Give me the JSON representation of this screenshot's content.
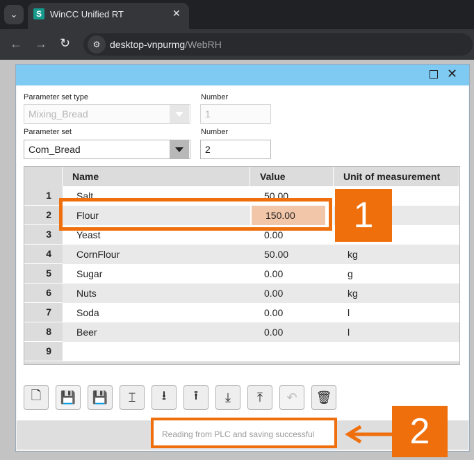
{
  "browser": {
    "tab_title": "WinCC Unified RT",
    "tab_favicon": "S",
    "url_host": "desktop-vnpurmg",
    "url_path": "/WebRH"
  },
  "form": {
    "param_type_label": "Parameter set type",
    "param_type_value": "Mixing_Bread",
    "number1_label": "Number",
    "number1_value": "1",
    "param_set_label": "Parameter set",
    "param_set_value": "Com_Bread",
    "number2_label": "Number",
    "number2_value": "2"
  },
  "table": {
    "columns": [
      "Name",
      "Value",
      "Unit of measurement"
    ],
    "rows": [
      {
        "num": "1",
        "name": "Salt",
        "value": "50.00",
        "unit": ""
      },
      {
        "num": "2",
        "name": "Flour",
        "value": "150.00",
        "unit": ""
      },
      {
        "num": "3",
        "name": "Yeast",
        "value": "0.00",
        "unit": ""
      },
      {
        "num": "4",
        "name": "CornFlour",
        "value": "50.00",
        "unit": "kg"
      },
      {
        "num": "5",
        "name": "Sugar",
        "value": "0.00",
        "unit": "g"
      },
      {
        "num": "6",
        "name": "Nuts",
        "value": "0.00",
        "unit": "kg"
      },
      {
        "num": "7",
        "name": "Soda",
        "value": "0.00",
        "unit": "l"
      },
      {
        "num": "8",
        "name": "Beer",
        "value": "0.00",
        "unit": "l"
      },
      {
        "num": "9",
        "name": "",
        "value": "",
        "unit": ""
      }
    ]
  },
  "toolbar_buttons": [
    {
      "icon": "new-record-icon",
      "glyph": "🗋",
      "enabled": true
    },
    {
      "icon": "save-icon",
      "glyph": "💾",
      "enabled": false
    },
    {
      "icon": "save-as-icon",
      "glyph": "💾",
      "enabled": true
    },
    {
      "icon": "rename-icon",
      "glyph": "⌶",
      "enabled": true
    },
    {
      "icon": "write-to-plc-icon",
      "glyph": "⭳",
      "enabled": true
    },
    {
      "icon": "read-from-plc-icon",
      "glyph": "⭱",
      "enabled": true
    },
    {
      "icon": "import-icon",
      "glyph": "⤓",
      "enabled": true
    },
    {
      "icon": "export-icon",
      "glyph": "⤒",
      "enabled": true
    },
    {
      "icon": "undo-icon",
      "glyph": "↶",
      "enabled": false
    },
    {
      "icon": "delete-icon",
      "glyph": "🗑",
      "enabled": true
    }
  ],
  "status": {
    "text": "Reading from PLC and saving successful"
  },
  "callouts": {
    "one": "1",
    "two": "2"
  },
  "colors": {
    "accent": "#f06f0d",
    "title_bar": "#7fcaf2",
    "selected_cell": "#f2c6a8"
  }
}
